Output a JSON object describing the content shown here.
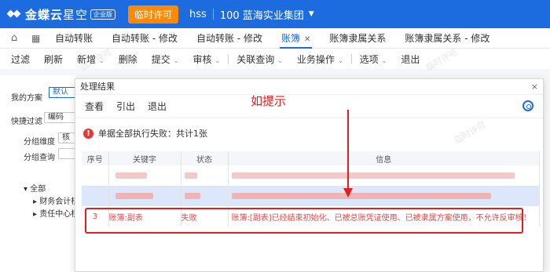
{
  "header": {
    "brand": "金蝶云",
    "product": "星空",
    "edition_badge": "企业版",
    "trial_button": "临时许可",
    "user": "hss",
    "org": "100 蓝海实业集团"
  },
  "tabs": [
    {
      "label": "自动转账"
    },
    {
      "label": "自动转账 - 修改"
    },
    {
      "label": "自动转账 - 修改"
    },
    {
      "label": "账簿"
    },
    {
      "label": "账簿隶属关系"
    },
    {
      "label": "账簿隶属关系 - 修改"
    }
  ],
  "toolbar": {
    "items": [
      "过滤",
      "刷新",
      "新增",
      "删除",
      "提交",
      "审核",
      "关联查询",
      "业务操作",
      "选项",
      "退出"
    ]
  },
  "left_panel": {
    "my_scheme": "我的方案",
    "default_scheme": "默认方",
    "quick_filter": "快捷过滤",
    "code_field": "编码",
    "group_dimension": "分组维度",
    "group_dimension_value": "核算",
    "group_query": "分组查询",
    "tree_root": "全部",
    "tree_item_1": "财务会计核",
    "tree_item_2": "责任中心核"
  },
  "watermark": "临时许可",
  "dialog": {
    "title": "处理结果",
    "close": "×",
    "buttons": [
      "查看",
      "引出",
      "退出"
    ],
    "hint": "如提示",
    "message": "单据全部执行失败：共计1张",
    "columns": [
      "序号",
      "关键字",
      "状态",
      "信息"
    ],
    "rows": [
      {
        "no": "",
        "key": "",
        "status": "",
        "info": ""
      },
      {
        "no": "",
        "key": "",
        "status": "",
        "info": ""
      },
      {
        "no": "3",
        "key": "账簿:副表",
        "status": "失败",
        "info": "账簿:[副表]已经结束初始化、已被总账凭证使用、已被隶属方案使用，不允许反审核！"
      }
    ]
  },
  "colors": {
    "brand_blue": "#1c6ce0",
    "trial_orange": "#ff8a00",
    "error_red": "#e84a4a",
    "annotation_red": "#e02020"
  }
}
